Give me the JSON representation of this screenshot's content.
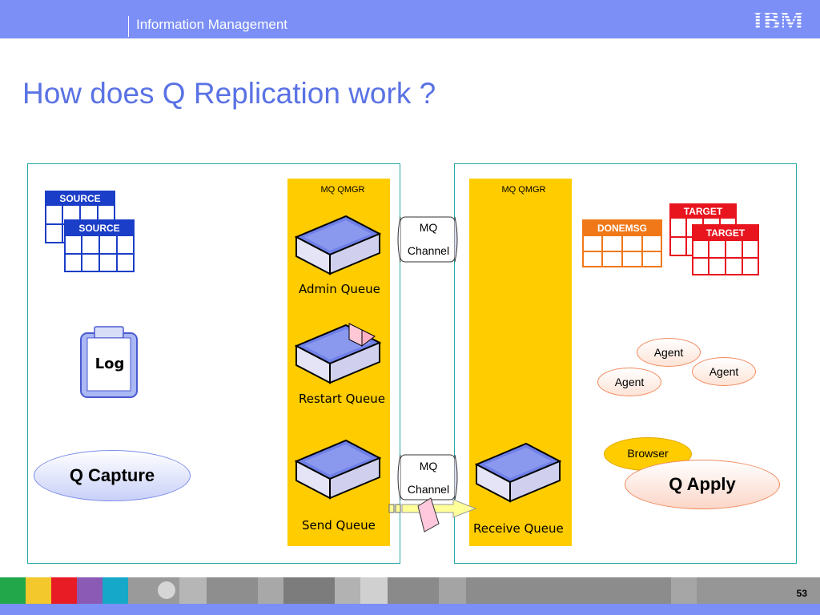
{
  "header": {
    "title": "Information Management",
    "logo_text": "IBM",
    "bg_color": "#7b8ff7"
  },
  "slide": {
    "title": "How does Q Replication work ?",
    "page_number": "53"
  },
  "left": {
    "qmgr_label": "MQ QMGR",
    "source_tables": [
      "SOURCE",
      "SOURCE"
    ],
    "log_label": "Log",
    "capture_label": "Q Capture",
    "queues": {
      "admin": "Admin Queue",
      "restart": "Restart Queue",
      "send": "Send Queue"
    }
  },
  "channels": [
    {
      "line1": "MQ",
      "line2": "Channel"
    },
    {
      "line1": "MQ",
      "line2": "Channel"
    }
  ],
  "right": {
    "qmgr_label": "MQ QMGR",
    "receive_queue": "Receive Queue",
    "donemsg_label": "DONEMSG",
    "target_tables": [
      "TARGET",
      "TARGET"
    ],
    "agents": [
      "Agent",
      "Agent",
      "Agent"
    ],
    "browser_label": "Browser",
    "apply_label": "Q Apply"
  },
  "colors": {
    "source": "#1a3ec8",
    "target": "#e8141e",
    "donemsg": "#f07818",
    "qmgr": "#ffcc00",
    "title": "#5a72e4"
  }
}
